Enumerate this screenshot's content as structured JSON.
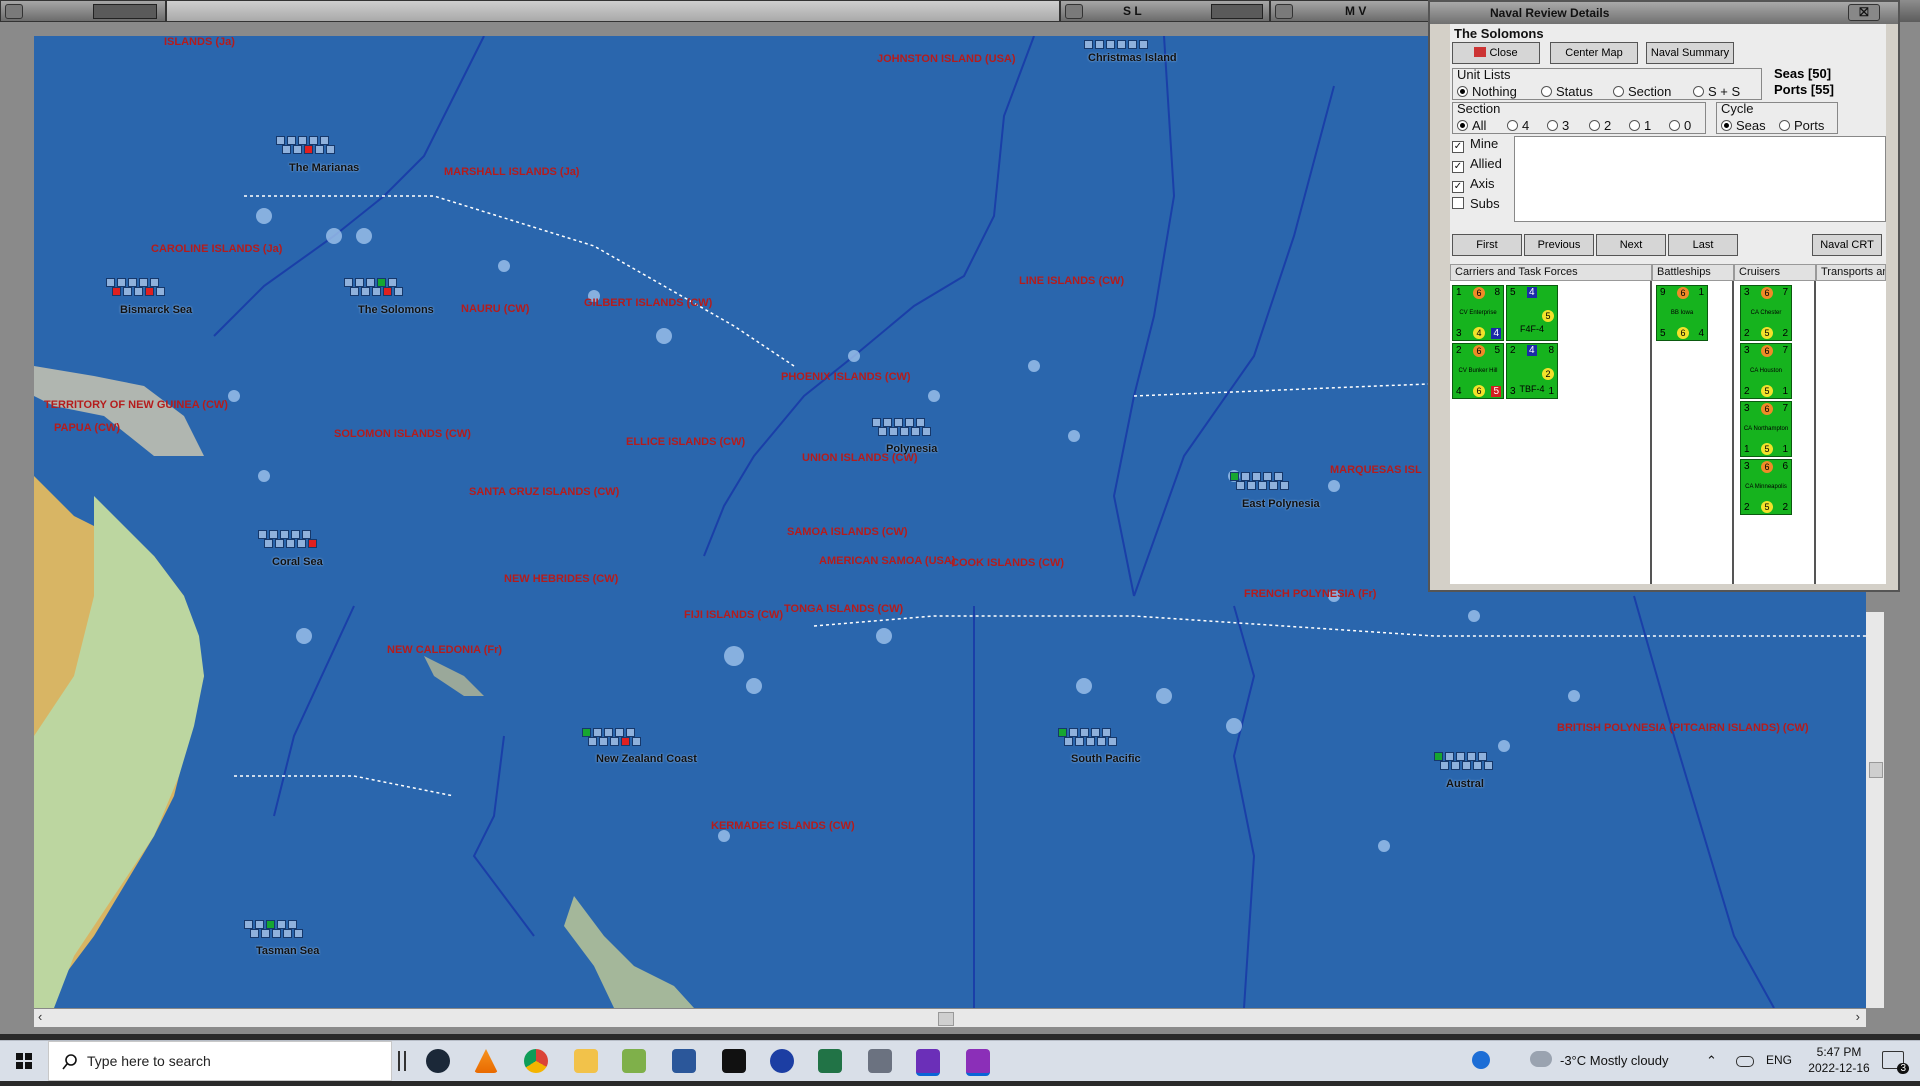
{
  "windows": {
    "win2_title": "S L",
    "win3_title": "M V"
  },
  "map": {
    "labels": [
      {
        "text": "ISLANDS (Ja)"
      },
      {
        "text": "JOHNSTON ISLAND (USA)"
      },
      {
        "text": "MARSHALL ISLANDS (Ja)"
      },
      {
        "text": "CAROLINE ISLANDS (Ja)"
      },
      {
        "text": "GILBERT ISLANDS (CW)"
      },
      {
        "text": "NAURU (CW)"
      },
      {
        "text": "LINE ISLANDS (CW)"
      },
      {
        "text": "PHOENIX ISLANDS (CW)"
      },
      {
        "text": "TERRITORY OF NEW GUINEA (CW)"
      },
      {
        "text": "PAPUA (CW)"
      },
      {
        "text": "SOLOMON ISLANDS (CW)"
      },
      {
        "text": "ELLICE ISLANDS (CW)"
      },
      {
        "text": "UNION ISLANDS (CW)"
      },
      {
        "text": "SANTA CRUZ ISLANDS (CW)"
      },
      {
        "text": "MARQUESAS ISL"
      },
      {
        "text": "SAMOA ISLANDS (CW)"
      },
      {
        "text": "AMERICAN SAMOA (USA)"
      },
      {
        "text": "COOK ISLANDS (CW)"
      },
      {
        "text": "NEW HEBRIDES (CW)"
      },
      {
        "text": "FIJI ISLANDS (CW)"
      },
      {
        "text": "TONGA ISLANDS (CW)"
      },
      {
        "text": "FRENCH POLYNESIA (Fr)"
      },
      {
        "text": "NEW CALEDONIA (Fr)"
      },
      {
        "text": "BRITISH POLYNESIA (PITCAIRN ISLANDS) (CW)"
      },
      {
        "text": "KERMADEC ISLANDS (CW)"
      }
    ],
    "sea_areas": [
      "Christmas Island",
      "The Marianas",
      "Bismarck Sea",
      "The Solomons",
      "Polynesia",
      "East Polynesia",
      "Coral Sea",
      "New Zealand Coast",
      "South Pacific",
      "Austral",
      "Tasman Sea"
    ]
  },
  "panel": {
    "title": "Naval Review Details",
    "sea_name": "The Solomons",
    "buttons": {
      "close": "Close",
      "center_map": "Center Map",
      "naval_summary": "Naval Summary",
      "first": "First",
      "previous": "Previous",
      "next": "Next",
      "last": "Last",
      "naval_crt": "Naval CRT"
    },
    "unit_lists": {
      "caption": "Unit Lists",
      "options": [
        "Nothing",
        "Status",
        "Section",
        "S + S"
      ],
      "selected": "Nothing"
    },
    "seas_count": "Seas [50]",
    "ports_count": "Ports [55]",
    "section": {
      "caption": "Section",
      "options": [
        "All",
        "4",
        "3",
        "2",
        "1",
        "0"
      ],
      "selected": "All"
    },
    "cycle": {
      "caption": "Cycle",
      "options": [
        "Seas",
        "Ports"
      ],
      "selected": "Seas"
    },
    "filters": [
      {
        "label": "Mine",
        "checked": true
      },
      {
        "label": "Allied",
        "checked": true
      },
      {
        "label": "Axis",
        "checked": true
      },
      {
        "label": "Subs",
        "checked": false
      }
    ],
    "columns": [
      "Carriers and Task Forces",
      "Battleships",
      "Cruisers",
      "Transports and"
    ],
    "units": {
      "carriers": [
        {
          "name": "CV Enterprise",
          "tl": "1",
          "tc": "6",
          "tr": "8",
          "bl": "3",
          "bc": "4",
          "br": "4"
        },
        {
          "name": "F4F-4",
          "tl": "5",
          "tc": "4",
          "tr": "",
          "bl": "",
          "bc": "5",
          "br": ""
        },
        {
          "name": "CV Bunker Hill",
          "tl": "2",
          "tc": "6",
          "tr": "5",
          "bl": "4",
          "bc": "6",
          "br": "5"
        },
        {
          "name": "TBF-4",
          "tl": "2",
          "tc": "4",
          "tr": "8",
          "bl": "3",
          "bc": "2",
          "br": "1"
        }
      ],
      "battleships": [
        {
          "name": "BB Iowa",
          "tl": "9",
          "tc": "6",
          "tr": "1",
          "bl": "5",
          "bc": "6",
          "br": "4"
        }
      ],
      "cruisers": [
        {
          "name": "CA Chester",
          "tl": "3",
          "tc": "6",
          "tr": "7",
          "bl": "2",
          "bc": "5",
          "br": "2"
        },
        {
          "name": "CA Houston",
          "tl": "3",
          "tc": "6",
          "tr": "7",
          "bl": "2",
          "bc": "5",
          "br": "1"
        },
        {
          "name": "CA Northampton",
          "tl": "3",
          "tc": "6",
          "tr": "7",
          "bl": "1",
          "bc": "5",
          "br": "1"
        },
        {
          "name": "CA Minneapolis",
          "tl": "3",
          "tc": "6",
          "tr": "6",
          "bl": "2",
          "bc": "5",
          "br": "2"
        }
      ]
    }
  },
  "taskbar": {
    "search_placeholder": "Type here to search",
    "weather": "-3°C  Mostly cloudy",
    "language": "ENG",
    "time": "5:47 PM",
    "date": "2022-12-16",
    "notification_count": "3"
  }
}
